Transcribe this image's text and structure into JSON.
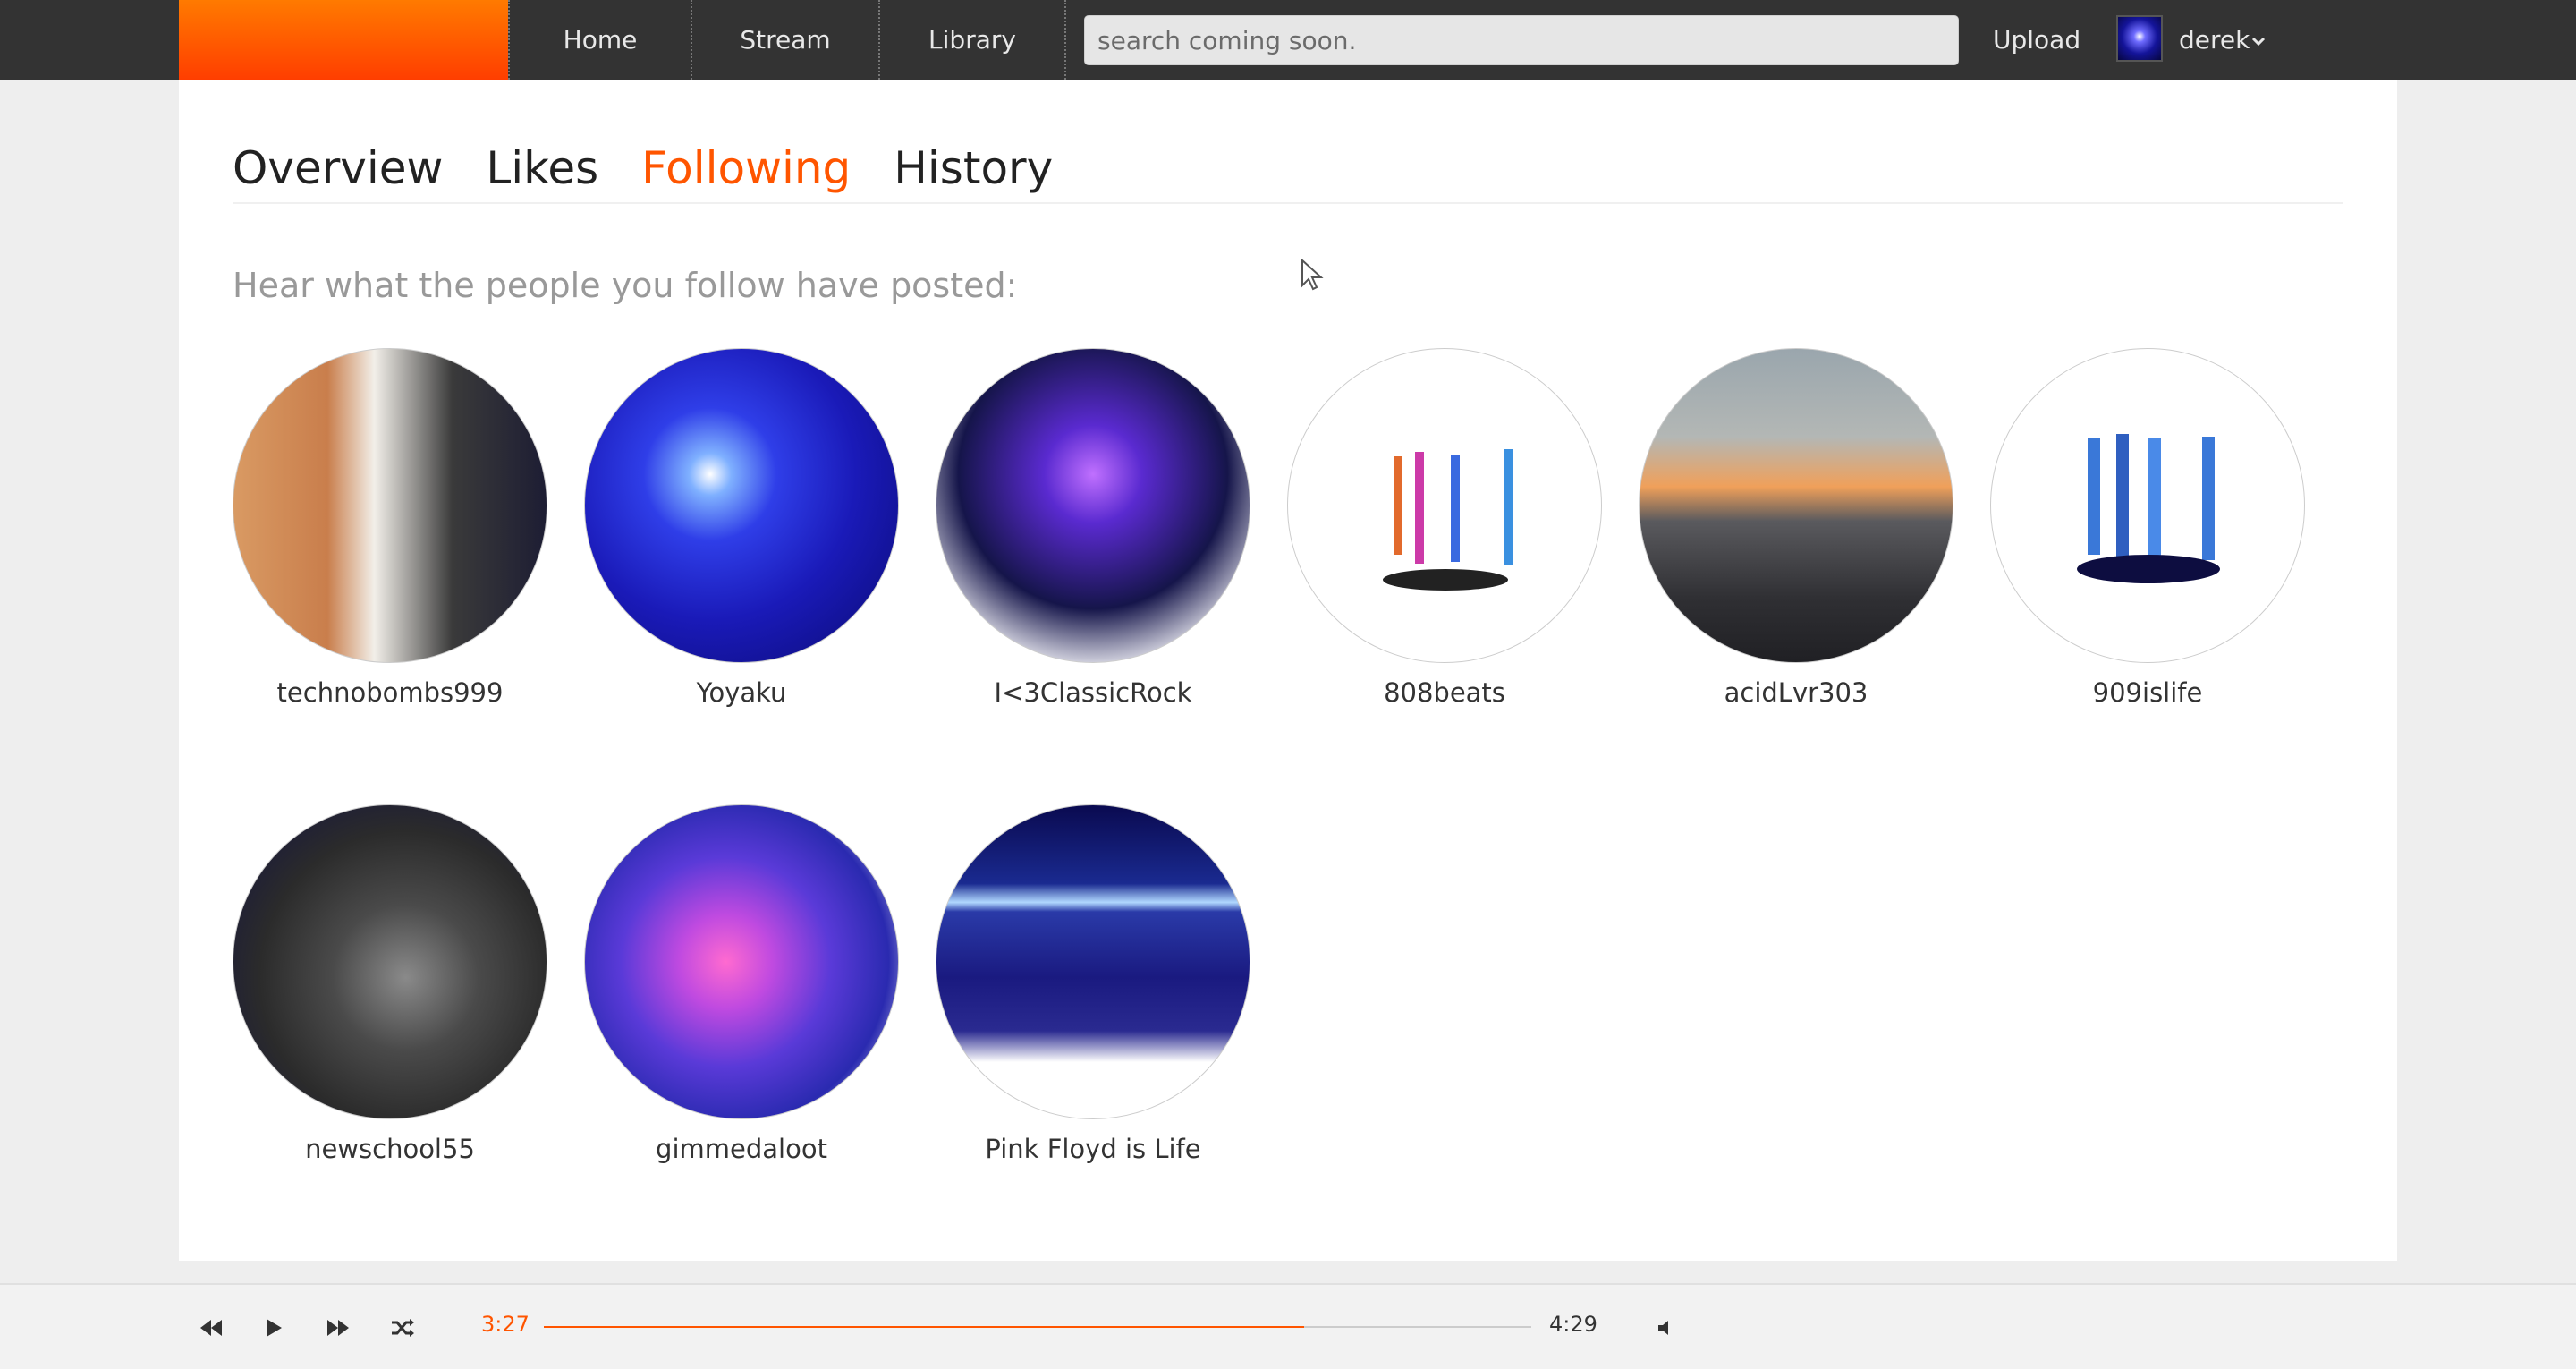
{
  "nav": {
    "home": "Home",
    "stream": "Stream",
    "library": "Library",
    "upload": "Upload",
    "username": "derek"
  },
  "search": {
    "placeholder": "search coming soon."
  },
  "tabs": [
    {
      "label": "Overview",
      "active": false
    },
    {
      "label": "Likes",
      "active": false
    },
    {
      "label": "Following",
      "active": true
    },
    {
      "label": "History",
      "active": false
    }
  ],
  "intro": "Hear what the people you follow have posted:",
  "following": [
    {
      "name": "technobombs999",
      "theme": "sunset-pier"
    },
    {
      "name": "Yoyaku",
      "theme": "blue-light"
    },
    {
      "name": "I<3ClassicRock",
      "theme": "disco-crowd"
    },
    {
      "name": "808beats",
      "theme": "led-pillars"
    },
    {
      "name": "acidLvr303",
      "theme": "parking-sunset"
    },
    {
      "name": "909islife",
      "theme": "blue-pillars"
    },
    {
      "name": "newschool55",
      "theme": "tunnel"
    },
    {
      "name": "gimmedaloot",
      "theme": "lasers"
    },
    {
      "name": "Pink Floyd is Life",
      "theme": "blue-beam"
    }
  ],
  "player": {
    "current_time": "3:27",
    "total_time": "4:29",
    "progress": 0.77
  },
  "colors": {
    "accent": "#ff5500",
    "topbar": "#333333"
  }
}
